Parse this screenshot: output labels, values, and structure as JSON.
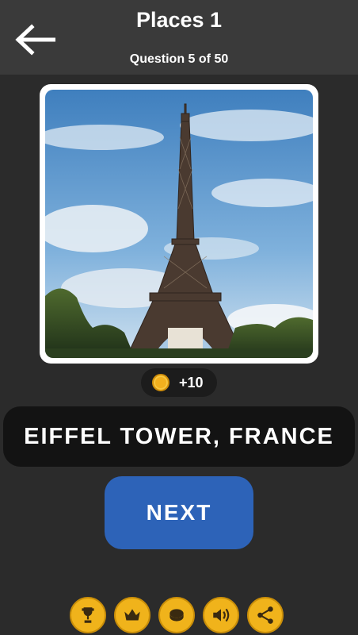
{
  "header": {
    "title": "Places 1",
    "subtitle": "Question 5 of 50",
    "back_icon": "arrow-left-icon"
  },
  "photo": {
    "subject": "eiffel-tower-photo"
  },
  "reward": {
    "coin_icon": "coin-icon",
    "text": "+10"
  },
  "answer": {
    "text": "EIFFEL TOWER, FRANCE"
  },
  "actions": {
    "next_label": "NEXT"
  },
  "bottom_bar": {
    "buttons": [
      "trophy-icon",
      "crown-icon",
      "coin-icon",
      "sound-icon",
      "share-icon"
    ]
  },
  "colors": {
    "background": "#2b2b2b",
    "header": "#3a3a3a",
    "accent_blue": "#2d63b8",
    "gold": "#f0b31b"
  }
}
